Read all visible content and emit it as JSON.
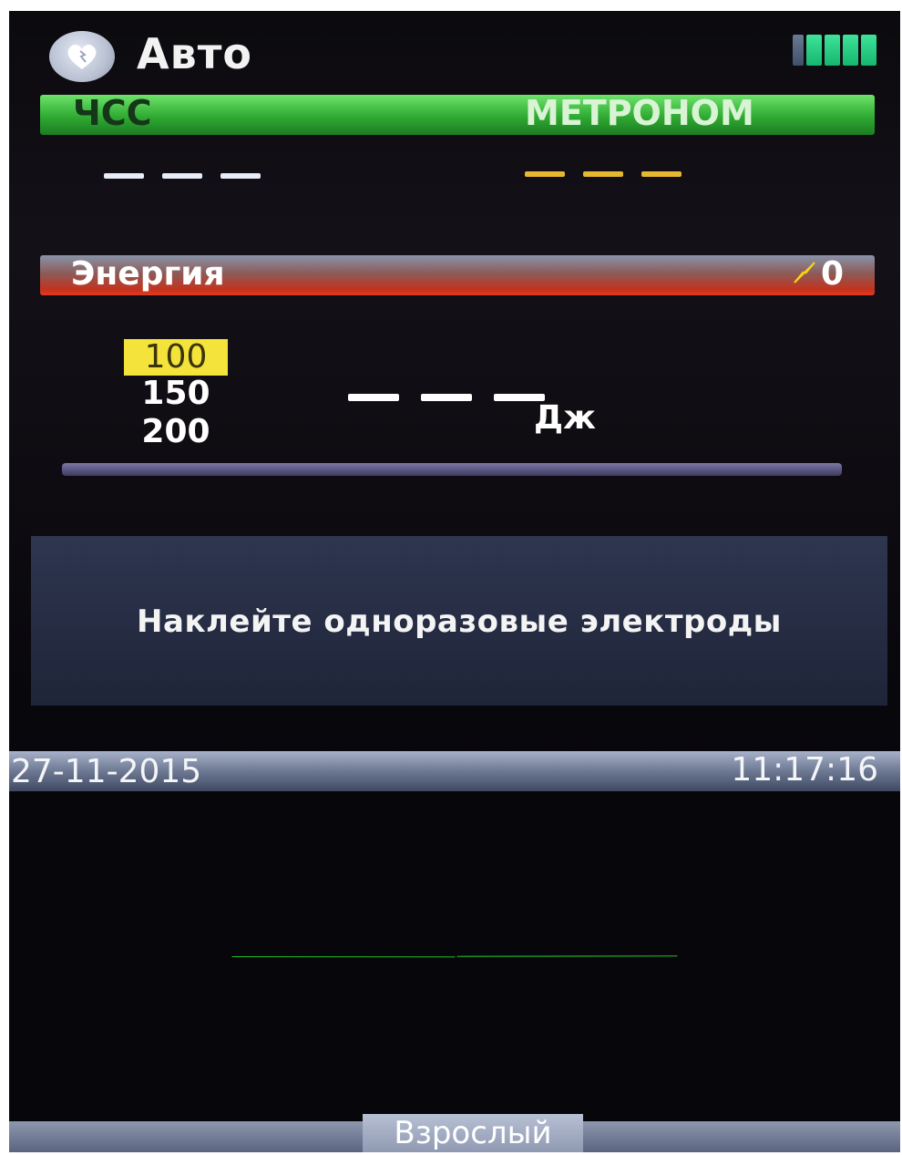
{
  "header": {
    "mode_title": "Авто",
    "mode_icon": "heart-bolt-icon",
    "battery_icon": "battery-icon",
    "battery_level": "full"
  },
  "vitals_bar": {
    "hr_label": "ЧСС",
    "metronome_label": "МЕТРОНОМ",
    "hr_value": "— — —",
    "metronome_value": "— — —"
  },
  "energy_bar": {
    "label": "Энергия",
    "shock_icon": "bolt-icon",
    "shock_count": "0"
  },
  "energy": {
    "options": [
      "100",
      "150",
      "200"
    ],
    "selected": "100",
    "value": "— — —",
    "unit": "Дж"
  },
  "message": {
    "text": "Наклейте одноразовые электроды"
  },
  "status": {
    "date": "27-11-2015",
    "time": "11:17:16"
  },
  "footer": {
    "patient_type": "Взрослый"
  },
  "colors": {
    "hr_bar": "#2faa32",
    "energy_bar": "#e23a1f",
    "metronome_dash": "#e6b830",
    "selected_energy": "#f4e33a",
    "ecg_trace": "#22c22a"
  }
}
